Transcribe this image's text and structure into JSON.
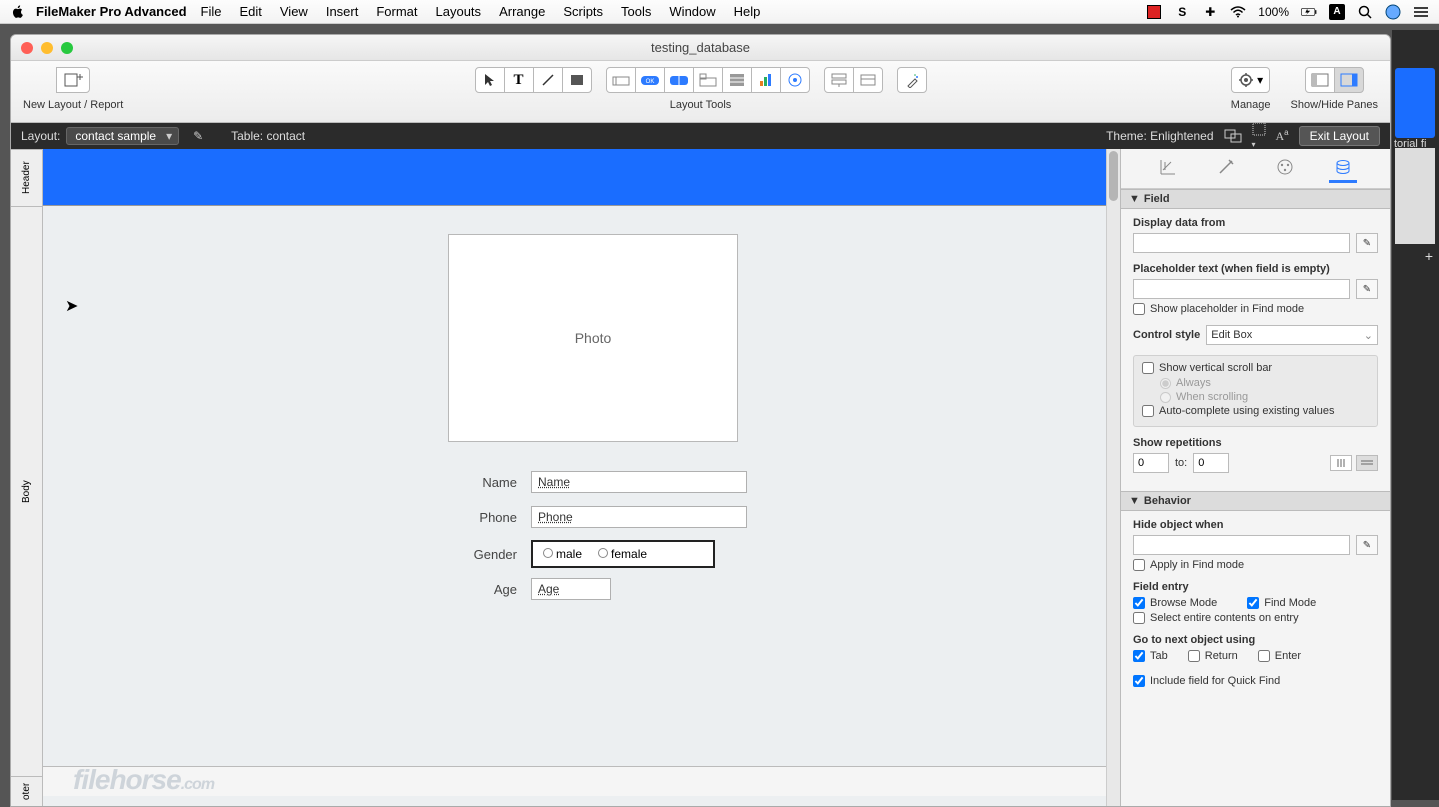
{
  "menubar": {
    "app": "FileMaker Pro Advanced",
    "items": [
      "File",
      "Edit",
      "View",
      "Insert",
      "Format",
      "Layouts",
      "Arrange",
      "Scripts",
      "Tools",
      "Window",
      "Help"
    ],
    "battery": "100%"
  },
  "window": {
    "title": "testing_database",
    "toolbar": {
      "new_layout_label": "New Layout / Report",
      "layout_tools_label": "Layout Tools",
      "manage_label": "Manage",
      "panes_label": "Show/Hide Panes"
    }
  },
  "statusbar": {
    "layout_label": "Layout:",
    "layout_value": "contact sample",
    "table_label": "Table: contact",
    "theme_label": "Theme: Enlightened",
    "exit_label": "Exit Layout"
  },
  "parts": {
    "header": "Header",
    "body": "Body",
    "footer": "oter"
  },
  "canvas": {
    "photo": "Photo",
    "fields": {
      "name_label": "Name",
      "name_value": "Name",
      "phone_label": "Phone",
      "phone_value": "Phone",
      "gender_label": "Gender",
      "gender_male": "male",
      "gender_female": "female",
      "age_label": "Age",
      "age_value": "Age"
    }
  },
  "inspector": {
    "field_section": "Field",
    "display_data": "Display data from",
    "placeholder_text": "Placeholder text (when field is empty)",
    "show_placeholder_find": "Show placeholder in Find mode",
    "control_style_label": "Control style",
    "control_style_value": "Edit Box",
    "show_vscroll": "Show vertical scroll bar",
    "scroll_always": "Always",
    "scroll_when": "When scrolling",
    "autocomplete": "Auto-complete using existing values",
    "show_reps": "Show repetitions",
    "rep_from": "0",
    "rep_to_label": "to:",
    "rep_to": "0",
    "behavior_section": "Behavior",
    "hide_when": "Hide object when",
    "apply_find": "Apply in Find mode",
    "field_entry": "Field entry",
    "browse_mode": "Browse Mode",
    "find_mode": "Find Mode",
    "select_entire": "Select entire contents on entry",
    "goto_next": "Go to next object using",
    "tab": "Tab",
    "return": "Return",
    "enter": "Enter",
    "quick_find": "Include field for Quick Find"
  },
  "bgstrip": {
    "text": "torial fi"
  },
  "watermark": {
    "a": "filehorse",
    "b": ".com"
  }
}
